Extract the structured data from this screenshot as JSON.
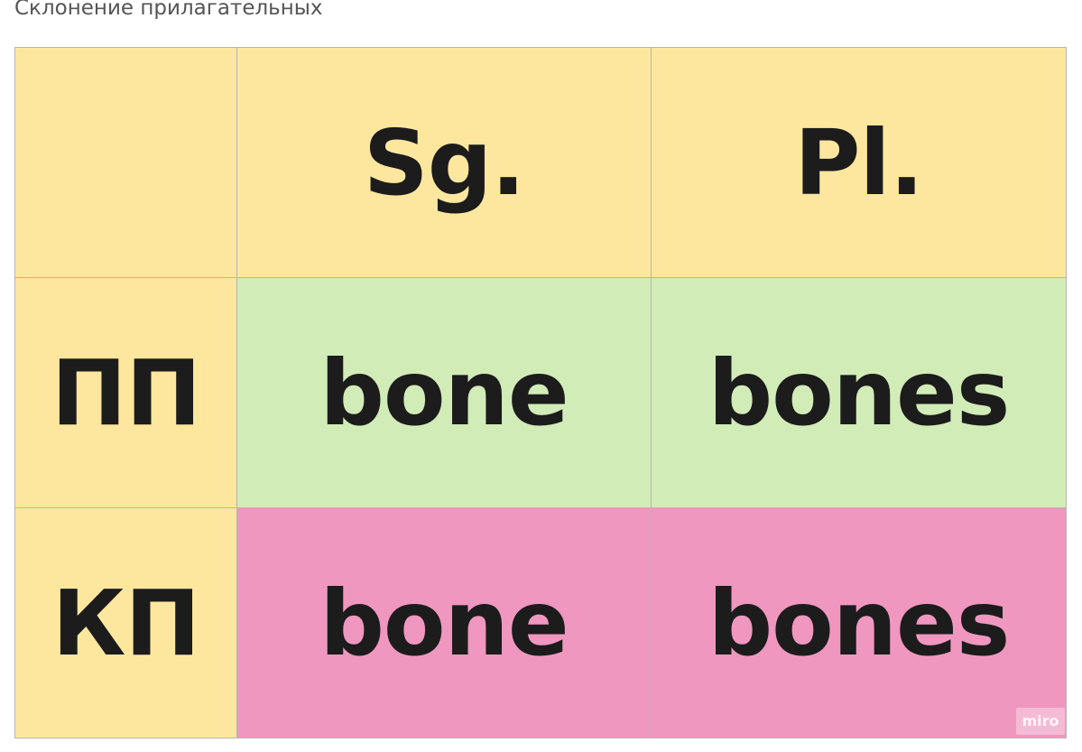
{
  "board": {
    "title": "Склонение прилагательных"
  },
  "table": {
    "corner": "",
    "columns": [
      "Sg.",
      "Pl."
    ],
    "rows": [
      {
        "label": "ПП",
        "cells": [
          "bone",
          "bones"
        ]
      },
      {
        "label": "КП",
        "cells": [
          "bone",
          "bones"
        ]
      }
    ]
  },
  "colors": {
    "header": "#fde79e",
    "row_pp": "#d2ecb8",
    "row_kp": "#f097c0",
    "text": "#1c1c1c",
    "grid_line": "#b5b5b5"
  },
  "watermark": {
    "text": "miro"
  }
}
